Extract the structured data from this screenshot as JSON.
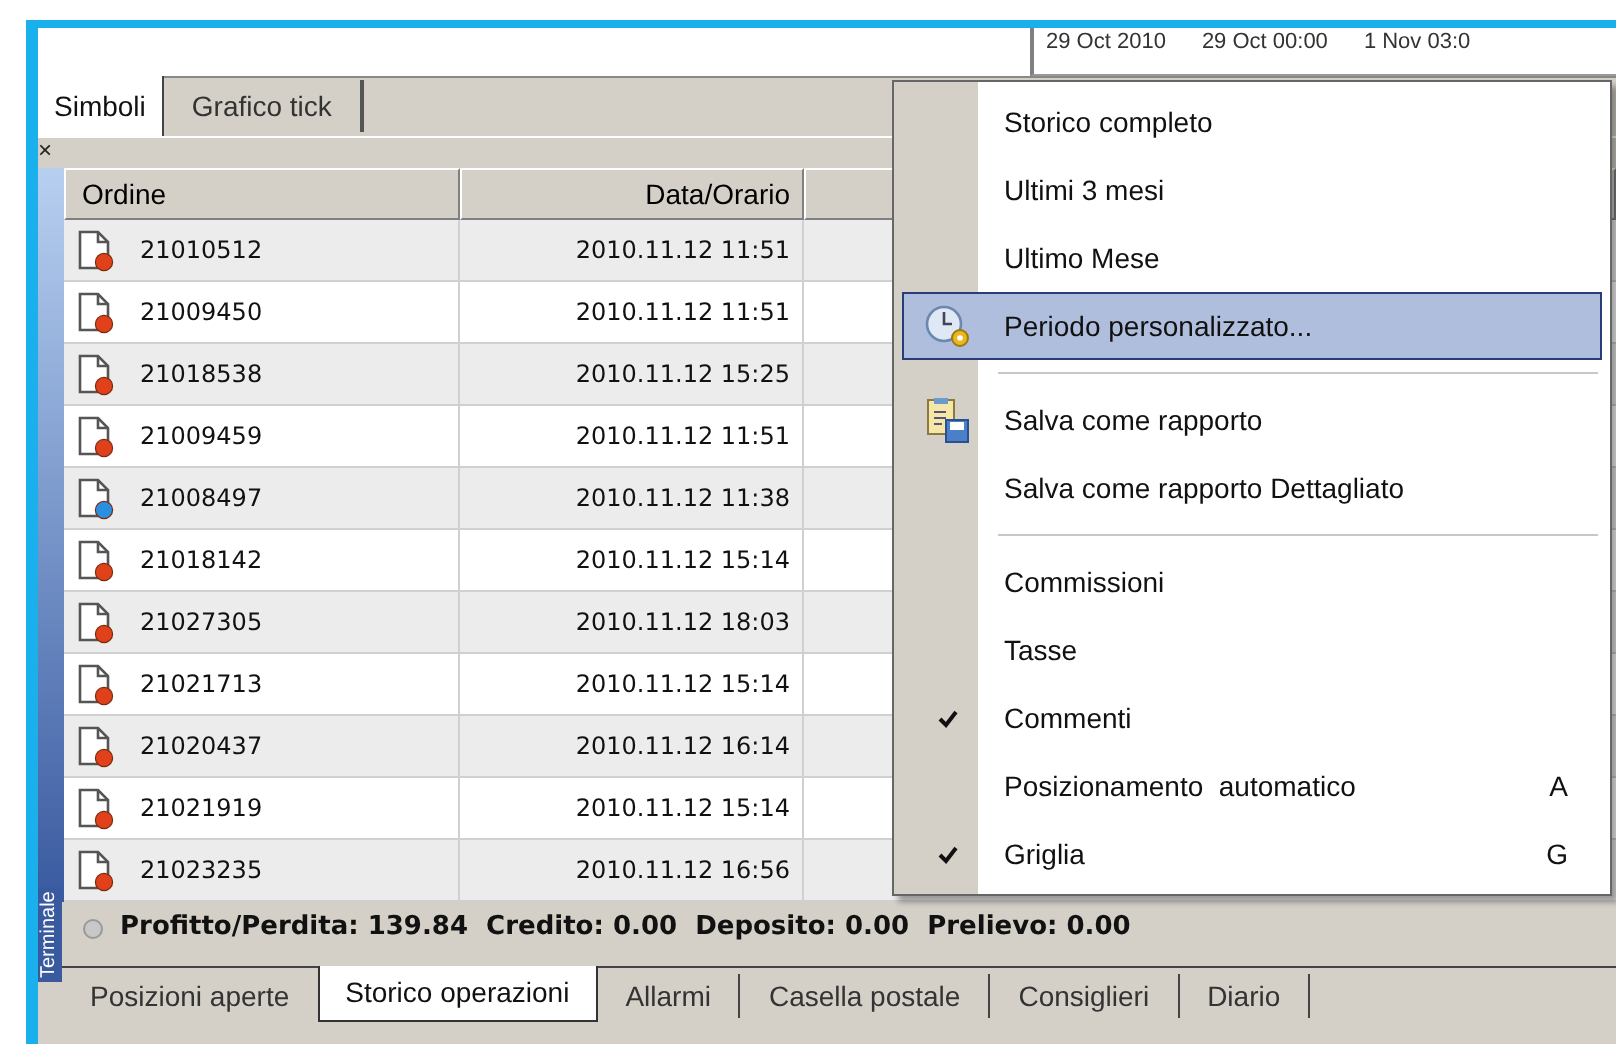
{
  "chart_axis": {
    "labels": [
      "29 Oct 2010",
      "29 Oct 00:00",
      "1 Nov 03:0"
    ]
  },
  "top_tabs": [
    {
      "label": "Simboli",
      "selected": true
    },
    {
      "label": "Grafico tick",
      "selected": false
    }
  ],
  "close_glyph": "×",
  "table": {
    "columns": [
      "Ordine",
      "Data/Orario"
    ],
    "rows": [
      {
        "order": "21010512",
        "time": "2010.11.12 11:51",
        "color": "#e0401a"
      },
      {
        "order": "21009450",
        "time": "2010.11.12 11:51",
        "color": "#e0401a"
      },
      {
        "order": "21018538",
        "time": "2010.11.12 15:25",
        "color": "#e0401a"
      },
      {
        "order": "21009459",
        "time": "2010.11.12 11:51",
        "color": "#e0401a"
      },
      {
        "order": "21008497",
        "time": "2010.11.12 11:38",
        "color": "#2b8fdf"
      },
      {
        "order": "21018142",
        "time": "2010.11.12 15:14",
        "color": "#e0401a"
      },
      {
        "order": "21027305",
        "time": "2010.11.12 18:03",
        "color": "#e0401a"
      },
      {
        "order": "21021713",
        "time": "2010.11.12 15:14",
        "color": "#e0401a"
      },
      {
        "order": "21020437",
        "time": "2010.11.12 16:14",
        "color": "#e0401a"
      },
      {
        "order": "21021919",
        "time": "2010.11.12 15:14",
        "color": "#e0401a"
      },
      {
        "order": "21023235",
        "time": "2010.11.12 16:56",
        "color": "#e0401a"
      }
    ]
  },
  "status_bar": "Profitto/Perdita: 139.84  Credito: 0.00  Deposito: 0.00  Prelievo: 0.00",
  "side_label": "Terminale",
  "bottom_tabs": [
    {
      "label": "Posizioni aperte",
      "selected": false
    },
    {
      "label": "Storico operazioni",
      "selected": true
    },
    {
      "label": "Allarmi",
      "selected": false
    },
    {
      "label": "Casella postale",
      "selected": false
    },
    {
      "label": "Consiglieri",
      "selected": false
    },
    {
      "label": "Diario",
      "selected": false
    }
  ],
  "context_menu": {
    "items": [
      {
        "kind": "item",
        "label": "Storico completo",
        "selected": false,
        "checked": false
      },
      {
        "kind": "item",
        "label": "Ultimi 3 mesi",
        "selected": false,
        "checked": false
      },
      {
        "kind": "item",
        "label": "Ultimo Mese",
        "selected": false,
        "checked": false
      },
      {
        "kind": "item",
        "label": "Periodo personalizzato...",
        "selected": true,
        "checked": false
      },
      {
        "kind": "separator"
      },
      {
        "kind": "item",
        "label": "Salva come rapporto",
        "selected": false,
        "checked": false
      },
      {
        "kind": "item",
        "label": "Salva come rapporto Dettagliato",
        "selected": false,
        "checked": false
      },
      {
        "kind": "separator"
      },
      {
        "kind": "item",
        "label": "Commissioni",
        "selected": false,
        "checked": false
      },
      {
        "kind": "item",
        "label": "Tasse",
        "selected": false,
        "checked": false
      },
      {
        "kind": "item",
        "label": "Commenti",
        "selected": false,
        "checked": true
      },
      {
        "kind": "item",
        "label": "Posizionamento  automatico",
        "selected": false,
        "checked": false,
        "shortcut": "A"
      },
      {
        "kind": "item",
        "label": "Griglia",
        "selected": false,
        "checked": true,
        "shortcut": "G"
      }
    ]
  }
}
